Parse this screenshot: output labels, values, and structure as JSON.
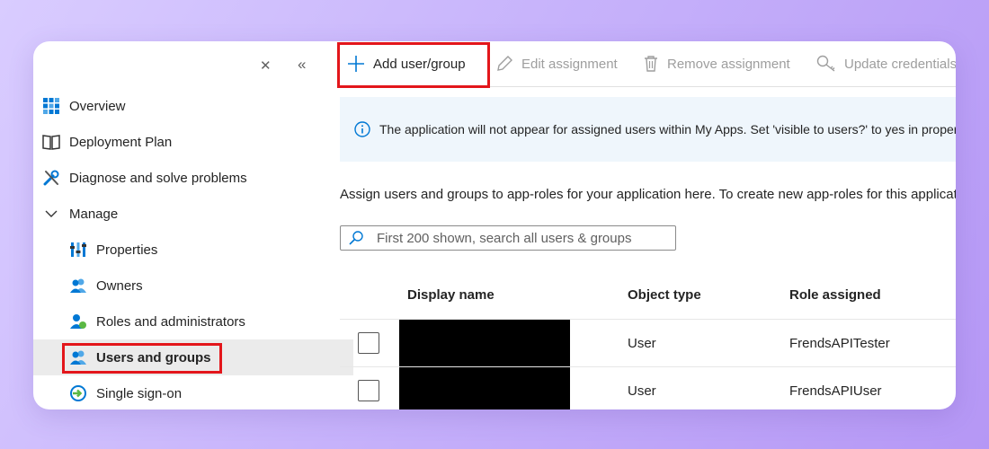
{
  "sidebar": {
    "items": [
      {
        "label": "Overview",
        "icon": "grid-icon"
      },
      {
        "label": "Deployment Plan",
        "icon": "book-icon"
      },
      {
        "label": "Diagnose and solve problems",
        "icon": "wrench-icon"
      },
      {
        "label": "Manage",
        "icon": "chevron-down-icon"
      },
      {
        "label": "Properties",
        "icon": "properties-icon"
      },
      {
        "label": "Owners",
        "icon": "owners-icon"
      },
      {
        "label": "Roles and administrators",
        "icon": "roles-icon"
      },
      {
        "label": "Users and groups",
        "icon": "users-groups-icon"
      },
      {
        "label": "Single sign-on",
        "icon": "sso-icon"
      }
    ]
  },
  "toolbar": {
    "add": "Add user/group",
    "edit": "Edit assignment",
    "remove": "Remove assignment",
    "update": "Update credentials"
  },
  "info": {
    "text": "The application will not appear for assigned users within My Apps. Set 'visible to users?' to yes in properties to enable this."
  },
  "description": "Assign users and groups to app-roles for your application here. To create new app-roles for this application, use the application registration.",
  "search": {
    "placeholder": "First 200 shown, search all users & groups"
  },
  "table": {
    "headers": [
      "Display name",
      "Object type",
      "Role assigned"
    ],
    "rows": [
      {
        "display_name": "",
        "object_type": "User",
        "role": "FrendsAPITester"
      },
      {
        "display_name": "",
        "object_type": "User",
        "role": "FrendsAPIUser"
      }
    ]
  },
  "colors": {
    "highlight": "#e3161b",
    "accent": "#0078d4",
    "active_bg": "#ebebeb",
    "info_bg": "#eff6fc"
  }
}
